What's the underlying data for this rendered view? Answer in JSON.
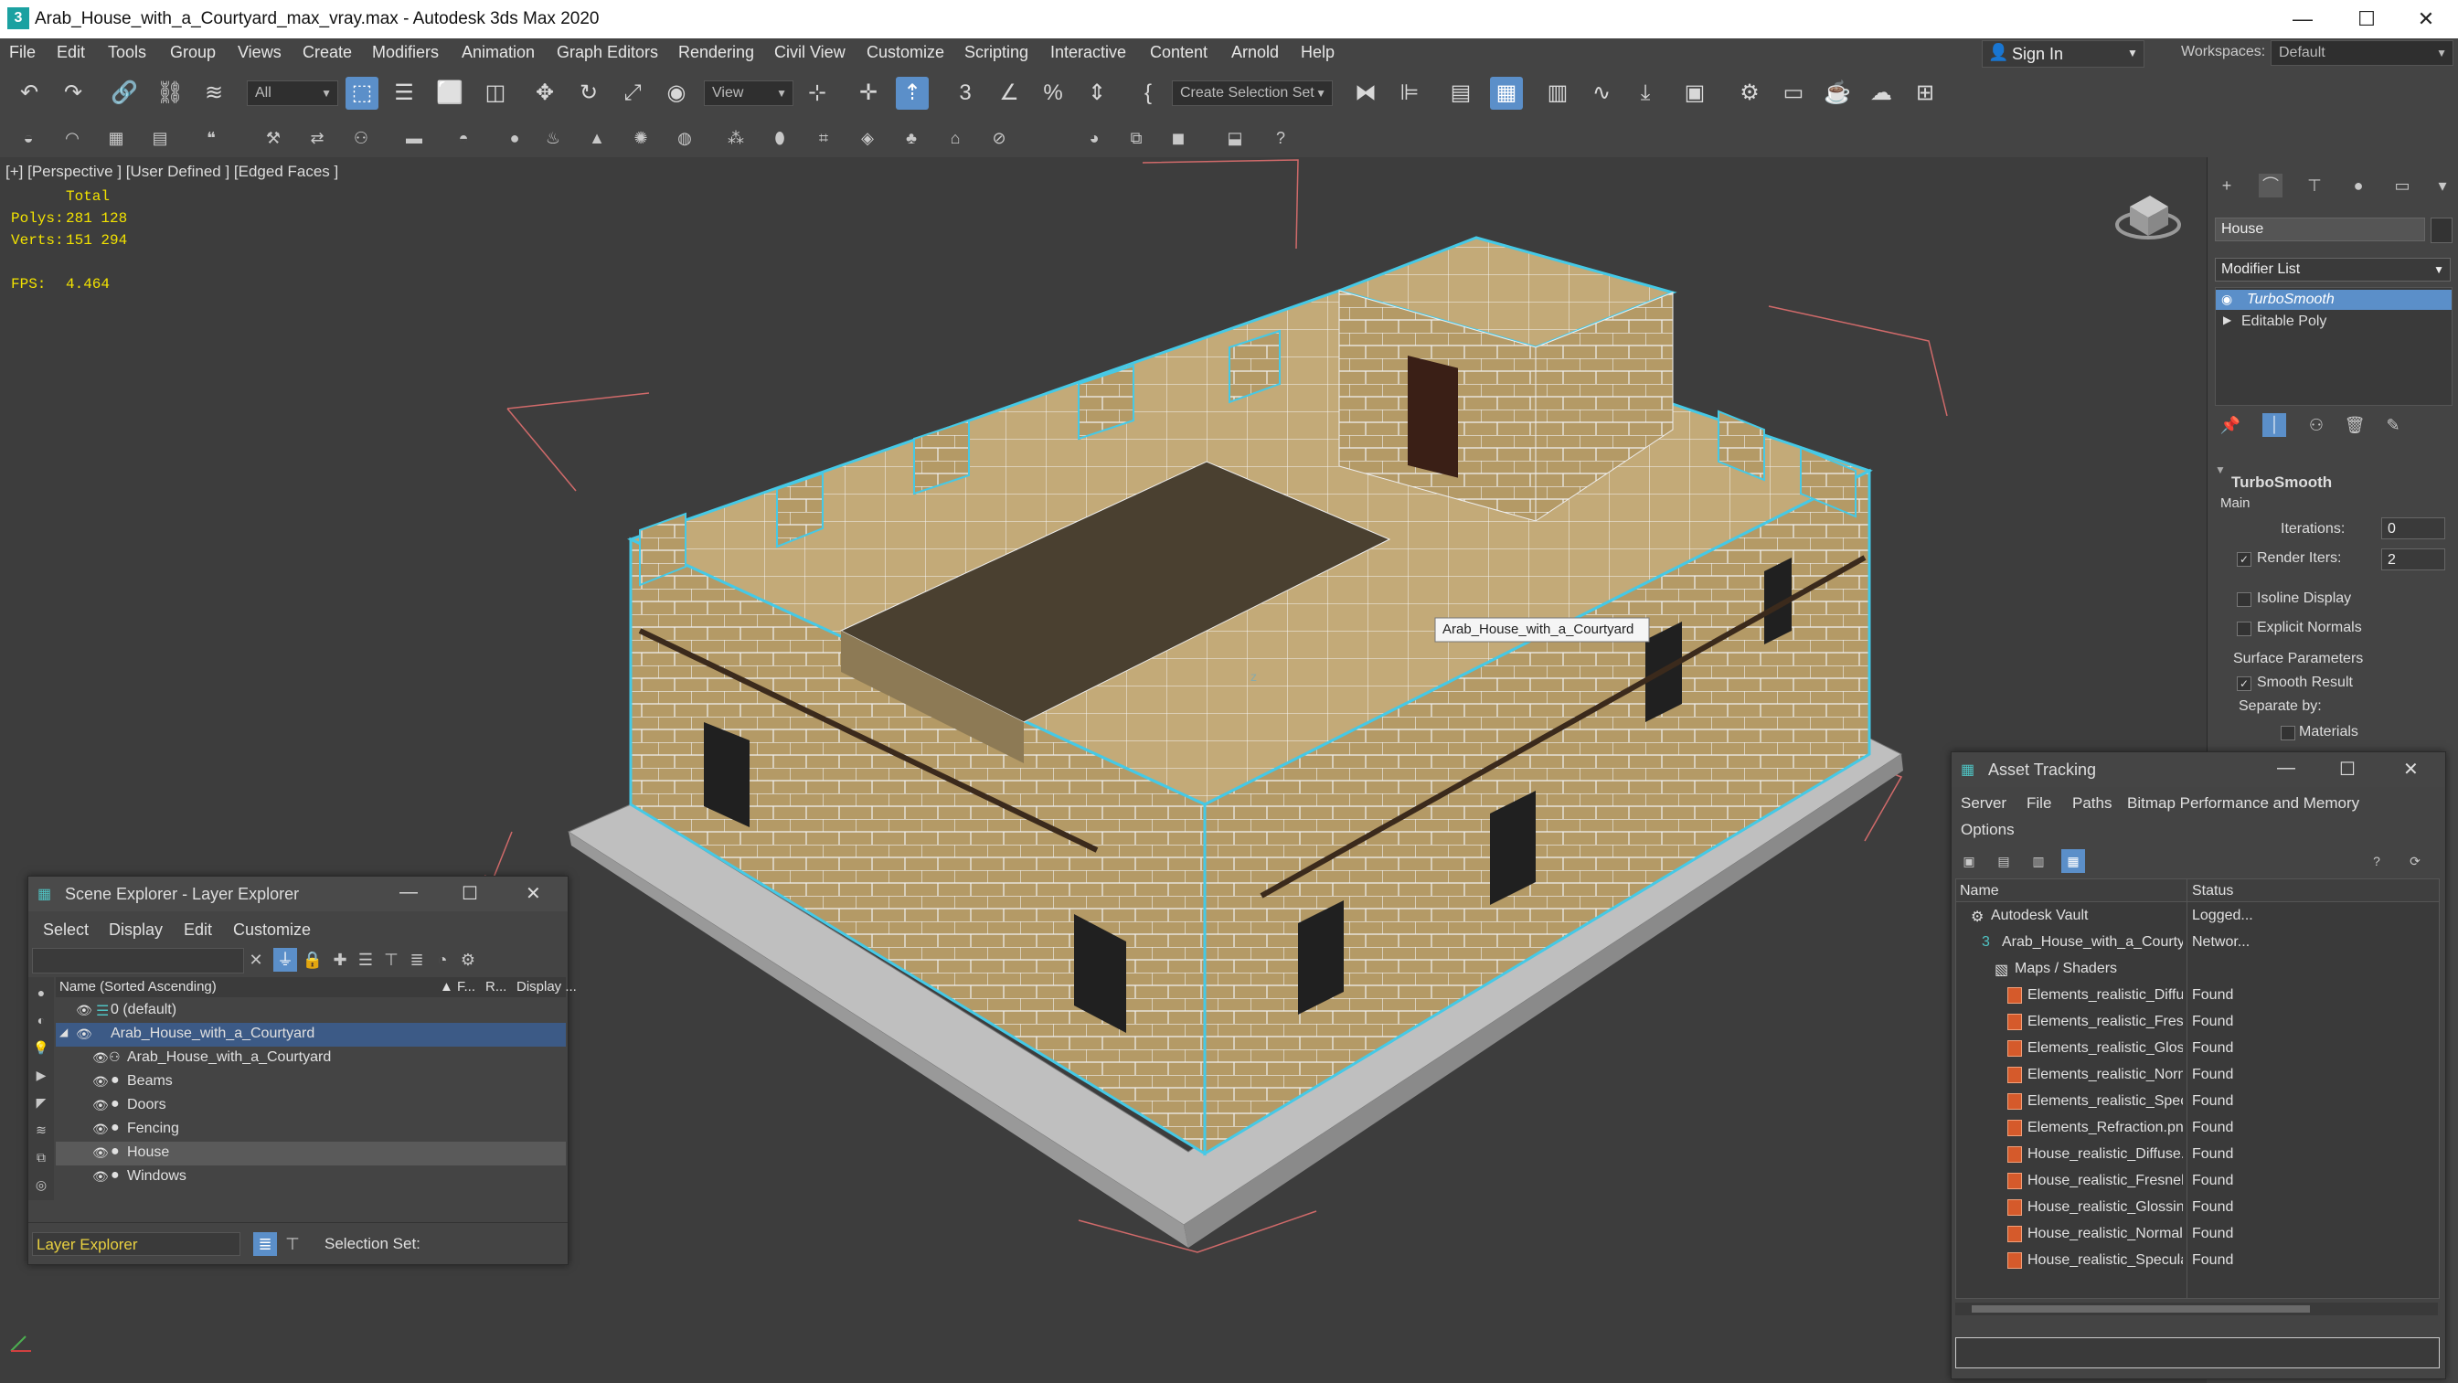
{
  "window": {
    "title": "Arab_House_with_a_Courtyard_max_vray.max - Autodesk 3ds Max 2020",
    "app_icon": "3"
  },
  "menu": [
    "File",
    "Edit",
    "Tools",
    "Group",
    "Views",
    "Create",
    "Modifiers",
    "Animation",
    "Graph Editors",
    "Rendering",
    "Civil View",
    "Customize",
    "Scripting",
    "Interactive",
    "Content",
    "Arnold",
    "Help"
  ],
  "account": {
    "sign_in": "Sign In",
    "workspaces_label": "Workspaces:",
    "workspace": "Default"
  },
  "toolbar": {
    "filter": "All",
    "ref_coord": "View",
    "selection_set": "Create Selection Set"
  },
  "viewport": {
    "label": "[+] [Perspective ] [User Defined ] [Edged Faces ]",
    "stats": {
      "total_label": "Total",
      "polys_label": "Polys:",
      "polys": "281 128",
      "verts_label": "Verts:",
      "verts": "151 294",
      "fps_label": "FPS:",
      "fps": "4.464"
    },
    "tooltip": "Arab_House_with_a_Courtyard",
    "axis": "z"
  },
  "command_panel": {
    "object_name": "House",
    "modifier_list": "Modifier List",
    "stack": [
      {
        "label": "TurboSmooth",
        "selected": true
      },
      {
        "label": "Editable Poly",
        "selected": false
      }
    ],
    "rollout_title": "TurboSmooth",
    "main_label": "Main",
    "iterations_label": "Iterations:",
    "iterations": "0",
    "render_iters_label": "Render Iters:",
    "render_iters": "2",
    "render_iters_checked": "✓",
    "isoline": "Isoline Display",
    "explicit": "Explicit Normals",
    "surface_params": "Surface Parameters",
    "smooth_result": "Smooth Result",
    "smooth_checked": "✓",
    "separate_by": "Separate by:",
    "materials": "Materials"
  },
  "scene_explorer": {
    "title": "Scene Explorer - Layer Explorer",
    "menu": [
      "Select",
      "Display",
      "Edit",
      "Customize"
    ],
    "columns": {
      "name": "Name (Sorted Ascending)",
      "frozen": "▲ F...",
      "render": "R...",
      "display": "Display ..."
    },
    "rows": [
      {
        "name": "0 (default)"
      },
      {
        "name": "Arab_House_with_a_Courtyard"
      },
      {
        "name": "Arab_House_with_a_Courtyard"
      },
      {
        "name": "Beams"
      },
      {
        "name": "Doors"
      },
      {
        "name": "Fencing"
      },
      {
        "name": "House"
      },
      {
        "name": "Windows"
      }
    ],
    "footer_explorer": "Layer Explorer",
    "selection_set_label": "Selection Set:"
  },
  "asset_tracking": {
    "title": "Asset Tracking",
    "menu": [
      "Server",
      "File",
      "Paths",
      "Bitmap Performance and Memory",
      "Options"
    ],
    "columns": {
      "name": "Name",
      "status": "Status"
    },
    "rows": [
      {
        "name": "Autodesk Vault",
        "status": "Logged..."
      },
      {
        "name": "Arab_House_with_a_Courtyard_max_vray.max",
        "status": "Networ..."
      },
      {
        "name": "Maps / Shaders",
        "status": ""
      },
      {
        "name": "Elements_realistic_Diffuse.png",
        "status": "Found"
      },
      {
        "name": "Elements_realistic_Fresnel.png",
        "status": "Found"
      },
      {
        "name": "Elements_realistic_Glossiness.png",
        "status": "Found"
      },
      {
        "name": "Elements_realistic_Normal.png",
        "status": "Found"
      },
      {
        "name": "Elements_realistic_Specular.png",
        "status": "Found"
      },
      {
        "name": "Elements_Refraction.png",
        "status": "Found"
      },
      {
        "name": "House_realistic_Diffuse.png",
        "status": "Found"
      },
      {
        "name": "House_realistic_Fresnel.png",
        "status": "Found"
      },
      {
        "name": "House_realistic_Glossiness.png",
        "status": "Found"
      },
      {
        "name": "House_realistic_Normal.png",
        "status": "Found"
      },
      {
        "name": "House_realistic_Specular.png",
        "status": "Found"
      }
    ]
  },
  "colors": {
    "accent": "#5b8fc9",
    "selection": "#45a6e6",
    "stats": "#f2e200",
    "bg": "#3d3d3d"
  }
}
